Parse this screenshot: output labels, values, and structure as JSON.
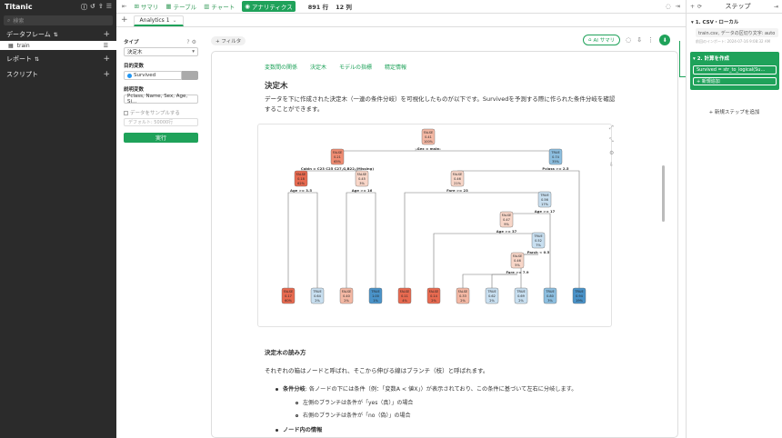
{
  "app": {
    "title": "Titanic"
  },
  "sidebar": {
    "search_placeholder": "検索",
    "dataframes_label": "データフレーム",
    "dataframe_item": "train",
    "reports_label": "レポート",
    "scripts_label": "スクリプト"
  },
  "toolbar": {
    "summary": "サマリ",
    "table": "テーブル",
    "chart": "チャート",
    "analytics": "アナリティクス",
    "rows": "891 行",
    "cols": "12 列"
  },
  "tabs": {
    "active": "Analytics 1"
  },
  "config": {
    "type_label": "タイプ",
    "type_value": "決定木",
    "target_label": "目的変数",
    "target_value": "Survived",
    "explanatory_label": "説明変数",
    "explanatory_value": "Pclass, Name, Sex, Age, Si…",
    "sample_label": "データをサンプルする",
    "sample_placeholder": "デフォルト: 50000行",
    "run_label": "実行"
  },
  "filter_label": "+ フィルタ",
  "ai_summary": "AI サマリ",
  "content": {
    "tabs": [
      "変数間の関係",
      "決定木",
      "モデルの指標",
      "精定情報"
    ],
    "title": "決定木",
    "desc": "データを下に作成された決定木（一連の条件分岐）を可視化したものが以下です。Survivedを予測する際に作られた条件分岐を確認することができます。",
    "how_title": "決定木の読み方",
    "how_desc": "それぞれの箱はノードと呼ばれ、そこから伸びる線はブランチ（枝）と呼ばれます。",
    "bullet1_bold": "条件分岐",
    "bullet1_rest": ": 各ノードの下には条件（例：「変数A < 値X」）が表示されており、この条件に基づいて左右に分岐します。",
    "sub1": "左側のブランチは条件が「yes（真）」の場合",
    "sub2": "右側のブランチは条件が「no（偽）」の場合",
    "bullet2": "ノード内の情報"
  },
  "tree": {
    "conditions": {
      "root": "Sex = male",
      "n1": "Cabin = C23 C25 C27,G,B22,(Missing)",
      "n2": "Pclass >= 2.5",
      "n3": "Age >= 3.5",
      "n4": "Age >= 16",
      "n5": "Fare >= 23",
      "n6": "Age >= 17",
      "n7": "Age >= 37",
      "n8": "Parch < 0.5",
      "n9": "Fare >= 7.9"
    },
    "yes": "yes",
    "no": "no",
    "nodes": {
      "root": [
        "FALSE",
        "0.41",
        "100%"
      ],
      "n1": [
        "FALSE",
        "0.21",
        "65%"
      ],
      "n2": [
        "TRUE",
        "0.74",
        "35%"
      ],
      "n3": [
        "FALSE",
        "0.18",
        "62%"
      ],
      "n4": [
        "FALSE",
        "0.45",
        "3%"
      ],
      "n5": [
        "FALSE",
        "0.46",
        "21%"
      ],
      "n6": [
        "TRUE",
        "0.56",
        "17%"
      ],
      "n7": [
        "FALSE",
        "0.47",
        "9%"
      ],
      "n8": [
        "TRUE",
        "0.52",
        "7%"
      ],
      "n9": [
        "FALSE",
        "0.46",
        "5%"
      ]
    },
    "leaves": [
      [
        "FALSE",
        "0.17",
        "60%"
      ],
      [
        "TRUE",
        "0.64",
        "2%"
      ],
      [
        "FALSE",
        "0.40",
        "2%"
      ],
      [
        "TRUE",
        "1.00",
        "1%"
      ],
      [
        "FALSE",
        "0.11",
        "4%"
      ],
      [
        "FALSE",
        "0.14",
        "2%"
      ],
      [
        "FALSE",
        "0.33",
        "2%"
      ],
      [
        "TRUE",
        "0.62",
        "2%"
      ],
      [
        "TRUE",
        "0.69",
        "2%"
      ],
      [
        "TRUE",
        "0.80",
        "3%"
      ],
      [
        "TRUE",
        "0.94",
        "19%"
      ]
    ]
  },
  "steps": {
    "title": "ステップ",
    "step1_title": "1. CSV・ローカル",
    "step1_box": "train.csv, データの区切り文字: auto",
    "step1_note": "前回のインポート: 2024-07-16 9:08:32 AM",
    "step2_title": "2. 計算を作成",
    "step2_box": "Survived = str_to_logical(Su…",
    "step2_add": "+ 新規追加",
    "new_step": "+ 新規ステップを追加"
  }
}
